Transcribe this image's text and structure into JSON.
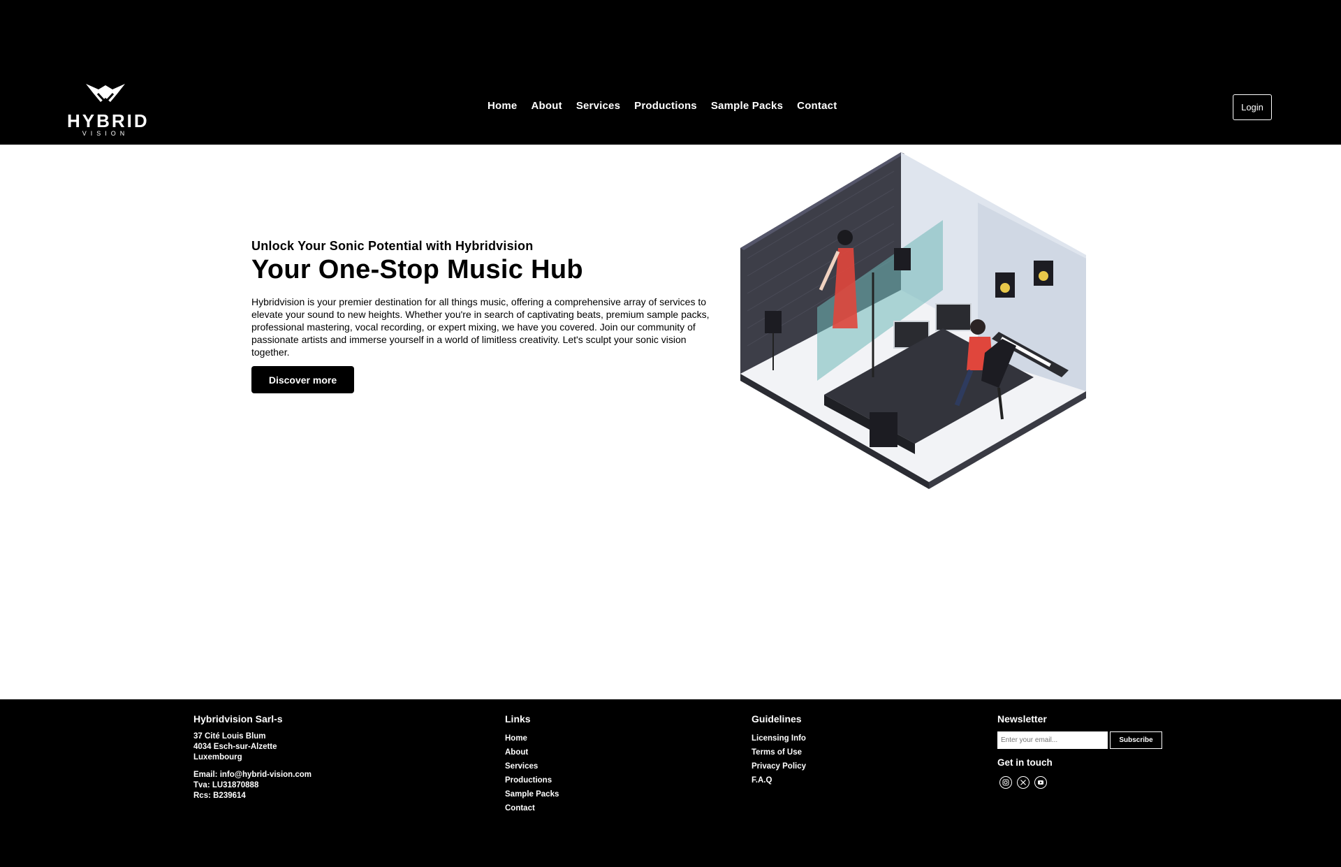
{
  "brand": {
    "name": "HYBRID",
    "sub": "VISION"
  },
  "nav": {
    "items": [
      "Home",
      "About",
      "Services",
      "Productions",
      "Sample Packs",
      "Contact"
    ],
    "login_label": "Login"
  },
  "hero": {
    "kicker": "Unlock Your Sonic Potential with Hybridvision",
    "title": "Your One-Stop Music Hub",
    "body": "Hybridvision is your premier destination for all things music, offering a comprehensive array of services to elevate your sound to new heights. Whether you're in search of captivating beats, premium sample packs, professional mastering, vocal recording, or expert mixing, we have you covered. Join our community of passionate artists and immerse yourself in a world of limitless creativity. Let's sculpt your sonic vision together.",
    "cta_label": "Discover more"
  },
  "footer": {
    "company": {
      "heading": "Hybridvision Sarl-s",
      "address": [
        "37 Cité Louis Blum",
        "4034 Esch-sur-Alzette",
        "Luxembourg"
      ],
      "legal": [
        "Email: info@hybrid-vision.com",
        "Tva: LU31870888",
        "Rcs: B239614"
      ]
    },
    "links": {
      "heading": "Links",
      "items": [
        "Home",
        "About",
        "Services",
        "Productions",
        "Sample Packs",
        "Contact"
      ]
    },
    "guidelines": {
      "heading": "Guidelines",
      "items": [
        "Licensing Info",
        "Terms of Use",
        "Privacy Policy",
        "F.A.Q"
      ]
    },
    "newsletter": {
      "heading": "Newsletter",
      "placeholder": "Enter your email...",
      "button_label": "Subscribe",
      "touch_heading": "Get in touch",
      "socials": [
        "instagram-icon",
        "x-icon",
        "youtube-icon"
      ]
    }
  },
  "colors": {
    "header_bg": "#000000",
    "footer_bg": "#000000",
    "accent_red": "#e0463c",
    "accent_teal": "#6fb8b8"
  }
}
